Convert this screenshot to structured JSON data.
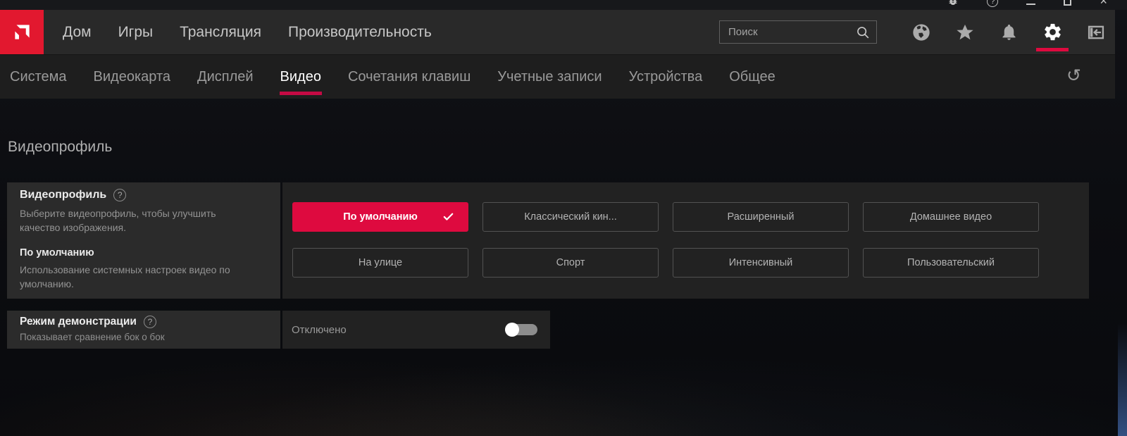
{
  "window": {
    "controls": [
      "bug-report",
      "help",
      "minimize",
      "maximize",
      "close"
    ]
  },
  "nav": {
    "items": [
      {
        "id": "home",
        "label": "Дом"
      },
      {
        "id": "games",
        "label": "Игры"
      },
      {
        "id": "streaming",
        "label": "Трансляция"
      },
      {
        "id": "performance",
        "label": "Производительность"
      }
    ],
    "search": {
      "placeholder": "Поиск",
      "value": ""
    },
    "icons": [
      "globe",
      "star",
      "bell",
      "gear",
      "panel-collapse"
    ],
    "active_icon": "gear"
  },
  "tabs": {
    "items": [
      {
        "id": "system",
        "label": "Система"
      },
      {
        "id": "graphics",
        "label": "Видеокарта"
      },
      {
        "id": "display",
        "label": "Дисплей"
      },
      {
        "id": "video",
        "label": "Видео"
      },
      {
        "id": "hotkeys",
        "label": "Сочетания клавиш"
      },
      {
        "id": "accounts",
        "label": "Учетные записи"
      },
      {
        "id": "devices",
        "label": "Устройства"
      },
      {
        "id": "general",
        "label": "Общее"
      }
    ],
    "active": "Видео",
    "reset_icon": "↺"
  },
  "page": {
    "section_title": "Видеопрофиль"
  },
  "video_profile": {
    "title": "Видеопрофиль",
    "help_glyph": "?",
    "description": "Выберите видеопрофиль, чтобы улучшить качество изображения.",
    "selected_option_title": "По умолчанию",
    "selected_option_description": "Использование системных настроек видео по умолчанию.",
    "selected": "По умолчанию",
    "options": [
      {
        "label": "По умолчанию",
        "selected": true
      },
      {
        "label": "Классический кин...",
        "selected": false
      },
      {
        "label": "Расширенный",
        "selected": false
      },
      {
        "label": "Домашнее видео",
        "selected": false
      },
      {
        "label": "На улице",
        "selected": false
      },
      {
        "label": "Спорт",
        "selected": false
      },
      {
        "label": "Интенсивный",
        "selected": false
      },
      {
        "label": "Пользовательский",
        "selected": false
      }
    ]
  },
  "demo_mode": {
    "title": "Режим демонстрации",
    "help_glyph": "?",
    "description": "Показывает сравнение бок о бок",
    "value": "Отключено",
    "enabled": false
  },
  "colors": {
    "accent_red": "#DE0A3F",
    "logo_red": "#E2182F",
    "tab_underline": "#C40A44",
    "card_left_bg": "#2b2b2b",
    "card_right_bg": "#222222",
    "navbar_bg": "#292929",
    "tabbar_bg": "#1e1e1e"
  }
}
